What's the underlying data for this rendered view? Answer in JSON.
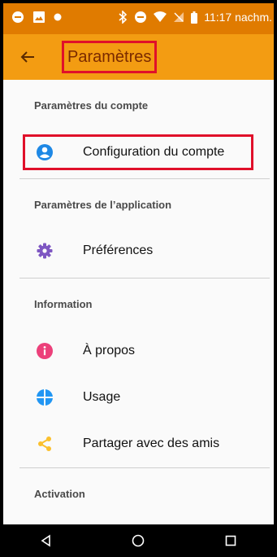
{
  "status_bar": {
    "time": "11:17 nachm.",
    "icons": [
      "minus-circle-icon",
      "image-icon",
      "dot-icon",
      "bluetooth-icon",
      "do-not-disturb-icon",
      "wifi-icon",
      "no-signal-icon",
      "battery-icon"
    ]
  },
  "app_bar": {
    "back_icon": "arrow-left-icon",
    "title": "Paramètres"
  },
  "sections": {
    "account": {
      "title": "Paramètres du compte",
      "items": [
        {
          "label": "Configuration du compte",
          "icon": "account-icon",
          "icon_color": "#1e88e5"
        }
      ]
    },
    "application": {
      "title": "Paramètres de l’application",
      "items": [
        {
          "label": "Préférences",
          "icon": "gear-icon",
          "icon_color": "#7e57c2"
        }
      ]
    },
    "information": {
      "title": "Information",
      "items": [
        {
          "label": "À propos",
          "icon": "info-icon",
          "icon_color": "#ec407a"
        },
        {
          "label": "Usage",
          "icon": "pie-icon",
          "icon_color": "#2196f3"
        },
        {
          "label": "Partager avec des amis",
          "icon": "share-icon",
          "icon_color": "#fbc02d"
        }
      ]
    },
    "activation": {
      "title": "Activation"
    }
  },
  "nav_bar": {
    "back_icon": "nav-back-icon",
    "home_icon": "nav-home-icon",
    "recents_icon": "nav-recents-icon"
  },
  "colors": {
    "status_bar": "#e07b00",
    "app_bar": "#f39c12",
    "highlight": "#e0102a"
  }
}
